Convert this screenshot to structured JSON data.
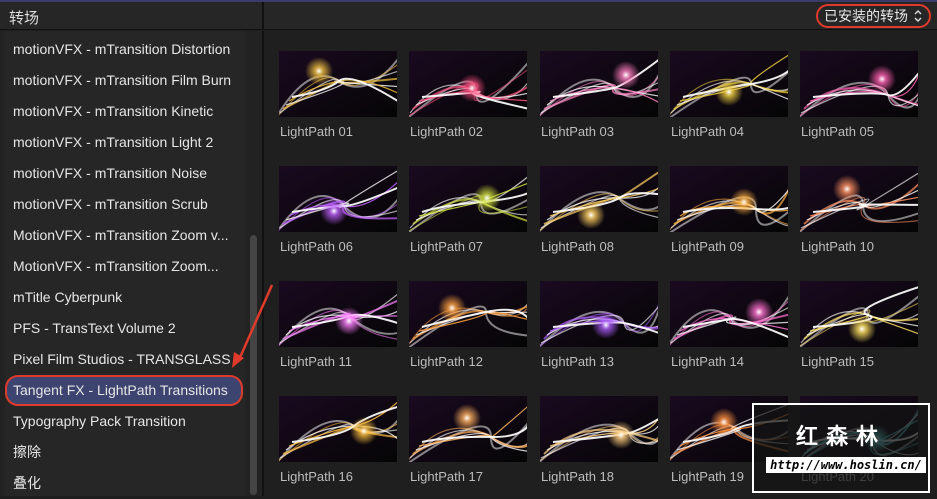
{
  "header": {
    "title": "转场",
    "filter": "已安装的转场",
    "filter_icon": "chevron-updown-icon"
  },
  "sidebar": {
    "items": [
      {
        "label": "motionVFX - mTransition Distortion"
      },
      {
        "label": "motionVFX - mTransition Film Burn"
      },
      {
        "label": "motionVFX - mTransition Kinetic"
      },
      {
        "label": "motionVFX - mTransition Light 2"
      },
      {
        "label": "motionVFX - mTransition Noise"
      },
      {
        "label": "motionVFX - mTransition Scrub"
      },
      {
        "label": "MotionVFX - mTransition Zoom v..."
      },
      {
        "label": "MotionVFX - mTransition Zoom..."
      },
      {
        "label": "mTitle Cyberpunk"
      },
      {
        "label": "PFS - TransText Volume 2"
      },
      {
        "label": "Pixel Film Studios - TRANSGLASS"
      },
      {
        "label": "Tangent FX - LightPath Transitions",
        "selected": true
      },
      {
        "label": "Typography Pack Transition"
      },
      {
        "label": "擦除"
      },
      {
        "label": "叠化"
      }
    ]
  },
  "grid": {
    "items": [
      {
        "label": "LightPath 01",
        "hue": "#f0c040"
      },
      {
        "label": "LightPath 02",
        "hue": "#ff5080"
      },
      {
        "label": "LightPath 03",
        "hue": "#ff80c0"
      },
      {
        "label": "LightPath 04",
        "hue": "#f0d040"
      },
      {
        "label": "LightPath 05",
        "hue": "#ff60b0"
      },
      {
        "label": "LightPath 06",
        "hue": "#c060ff"
      },
      {
        "label": "LightPath 07",
        "hue": "#d0e040"
      },
      {
        "label": "LightPath 08",
        "hue": "#ffd060"
      },
      {
        "label": "LightPath 09",
        "hue": "#ffb040"
      },
      {
        "label": "LightPath 10",
        "hue": "#ff9060"
      },
      {
        "label": "LightPath 11",
        "hue": "#ff80ff"
      },
      {
        "label": "LightPath 12",
        "hue": "#ffa040"
      },
      {
        "label": "LightPath 13",
        "hue": "#b060ff"
      },
      {
        "label": "LightPath 14",
        "hue": "#ff70d0"
      },
      {
        "label": "LightPath 15",
        "hue": "#ffe060"
      },
      {
        "label": "LightPath 16",
        "hue": "#ffc040"
      },
      {
        "label": "LightPath 17",
        "hue": "#ffb060"
      },
      {
        "label": "LightPath 18",
        "hue": "#ffd080"
      },
      {
        "label": "LightPath 19",
        "hue": "#ff9040"
      },
      {
        "label": "LightPath 20",
        "hue": "#60e0e0"
      }
    ]
  },
  "watermark": {
    "logo": "红森林",
    "url": "http://www.hoslin.cn/"
  }
}
